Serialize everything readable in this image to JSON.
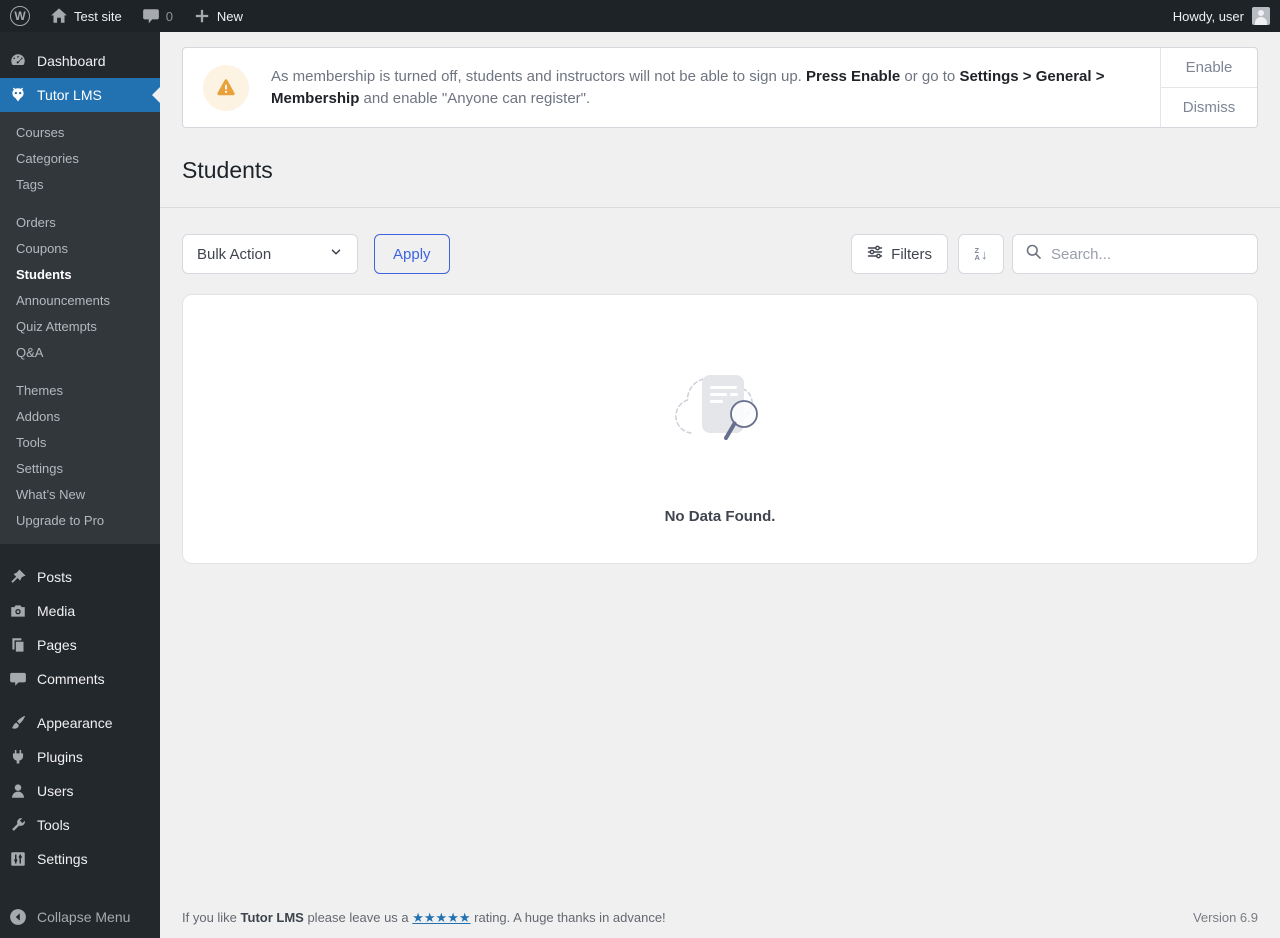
{
  "admin_bar": {
    "site_name": "Test site",
    "comment_count": "0",
    "new_label": "New",
    "howdy": "Howdy, user"
  },
  "sidebar": {
    "dashboard_label": "Dashboard",
    "tutor_label": "Tutor LMS",
    "tutor_submenu": [
      {
        "label": "Courses"
      },
      {
        "label": "Categories"
      },
      {
        "label": "Tags"
      },
      {
        "label": "Orders"
      },
      {
        "label": "Coupons"
      },
      {
        "label": "Students"
      },
      {
        "label": "Announcements"
      },
      {
        "label": "Quiz Attempts"
      },
      {
        "label": "Q&A"
      },
      {
        "label": "Themes"
      },
      {
        "label": "Addons"
      },
      {
        "label": "Tools"
      },
      {
        "label": "Settings"
      },
      {
        "label": "What’s New"
      },
      {
        "label": "Upgrade to Pro"
      }
    ],
    "menu_items": [
      {
        "label": "Posts"
      },
      {
        "label": "Media"
      },
      {
        "label": "Pages"
      },
      {
        "label": "Comments"
      },
      {
        "label": "Appearance"
      },
      {
        "label": "Plugins"
      },
      {
        "label": "Users"
      },
      {
        "label": "Tools"
      },
      {
        "label": "Settings"
      }
    ],
    "collapse_label": "Collapse Menu"
  },
  "notice": {
    "text_1": "As membership is turned off, students and instructors will not be able to sign up. ",
    "bold_1": "Press Enable",
    "text_2": " or go to ",
    "bold_2": "Settings > General > Membership",
    "text_3": " and enable \"Anyone can register\".",
    "enable_label": "Enable",
    "dismiss_label": "Dismiss"
  },
  "page": {
    "title": "Students",
    "bulk_action_label": "Bulk Action",
    "apply_label": "Apply",
    "filters_label": "Filters",
    "sort_top_letter": "Z",
    "sort_bottom_letter": "A",
    "sort_arrow": "↓",
    "search_placeholder": "Search...",
    "empty_message": "No Data Found."
  },
  "footer": {
    "pre": "If you like ",
    "brand": "Tutor LMS",
    "mid": " please leave us a ",
    "stars": "★★★★★",
    "post": " rating. A huge thanks in advance!",
    "version": "Version 6.9"
  },
  "colors": {
    "admin_bar_bg": "#1d2327",
    "menu_bg": "#23282d",
    "submenu_bg": "#32373c",
    "highlight_blue": "#2271b1",
    "content_bg": "#f0f0f1",
    "accent_blue": "#3e64de",
    "warning_orange": "#e9a13b",
    "warning_bg": "#fdf3e3"
  }
}
